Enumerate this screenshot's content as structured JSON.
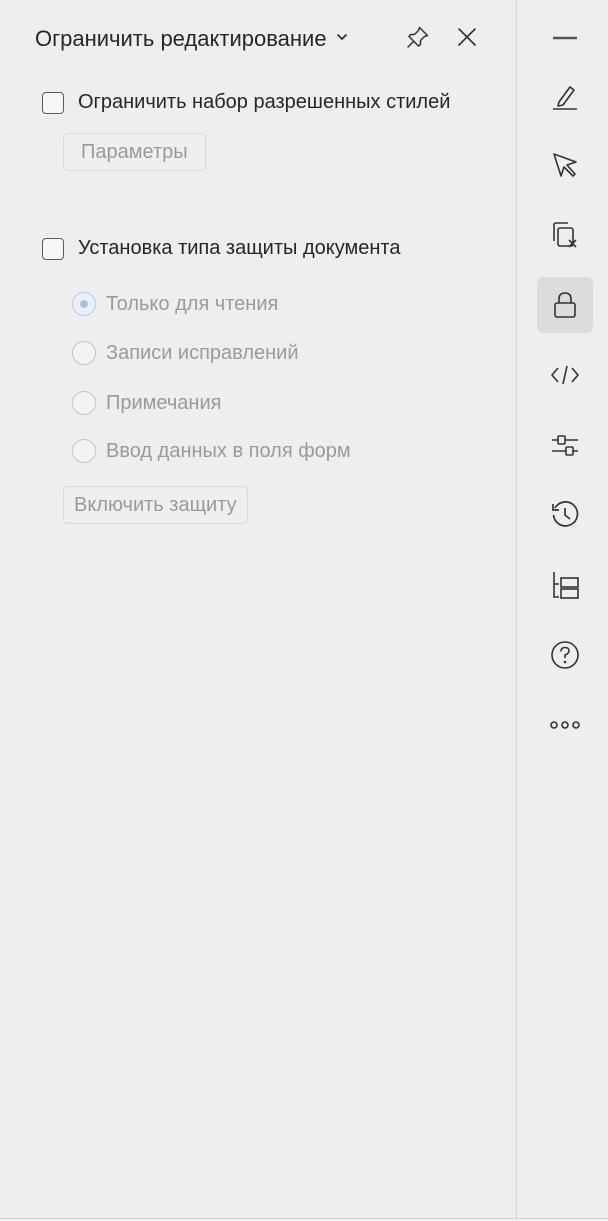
{
  "header": {
    "title": "Ограничить редактирование",
    "title_icon": "chevron-down-icon",
    "pin_icon": "pin-icon",
    "close_icon": "close-icon"
  },
  "formatting": {
    "checkbox_label": "Ограничить набор разрешенных стилей",
    "checked": false,
    "params_button": "Параметры"
  },
  "protection": {
    "checkbox_label": "Установка типа защиты документа",
    "checked": false,
    "options": [
      {
        "label": "Только для чтения",
        "selected": true
      },
      {
        "label": "Записи исправлений",
        "selected": false
      },
      {
        "label": "Примечания",
        "selected": false
      },
      {
        "label": "Ввод данных в поля форм",
        "selected": false
      }
    ],
    "enable_button": "Включить защиту"
  },
  "rail": {
    "items": [
      {
        "icon": "minimize-icon"
      },
      {
        "icon": "pen-icon"
      },
      {
        "icon": "cursor-icon"
      },
      {
        "icon": "copy-clear-icon"
      },
      {
        "icon": "lock-icon",
        "active": true
      },
      {
        "icon": "code-icon"
      },
      {
        "icon": "sliders-icon"
      },
      {
        "icon": "history-icon"
      },
      {
        "icon": "tree-icon"
      },
      {
        "icon": "help-icon"
      },
      {
        "icon": "more-icon"
      }
    ]
  },
  "colors": {
    "background": "#eeeeee",
    "active_rail": "#dcdcdc",
    "disabled_text": "#9a9a9a",
    "radio_accent": "#a9bfe3"
  }
}
